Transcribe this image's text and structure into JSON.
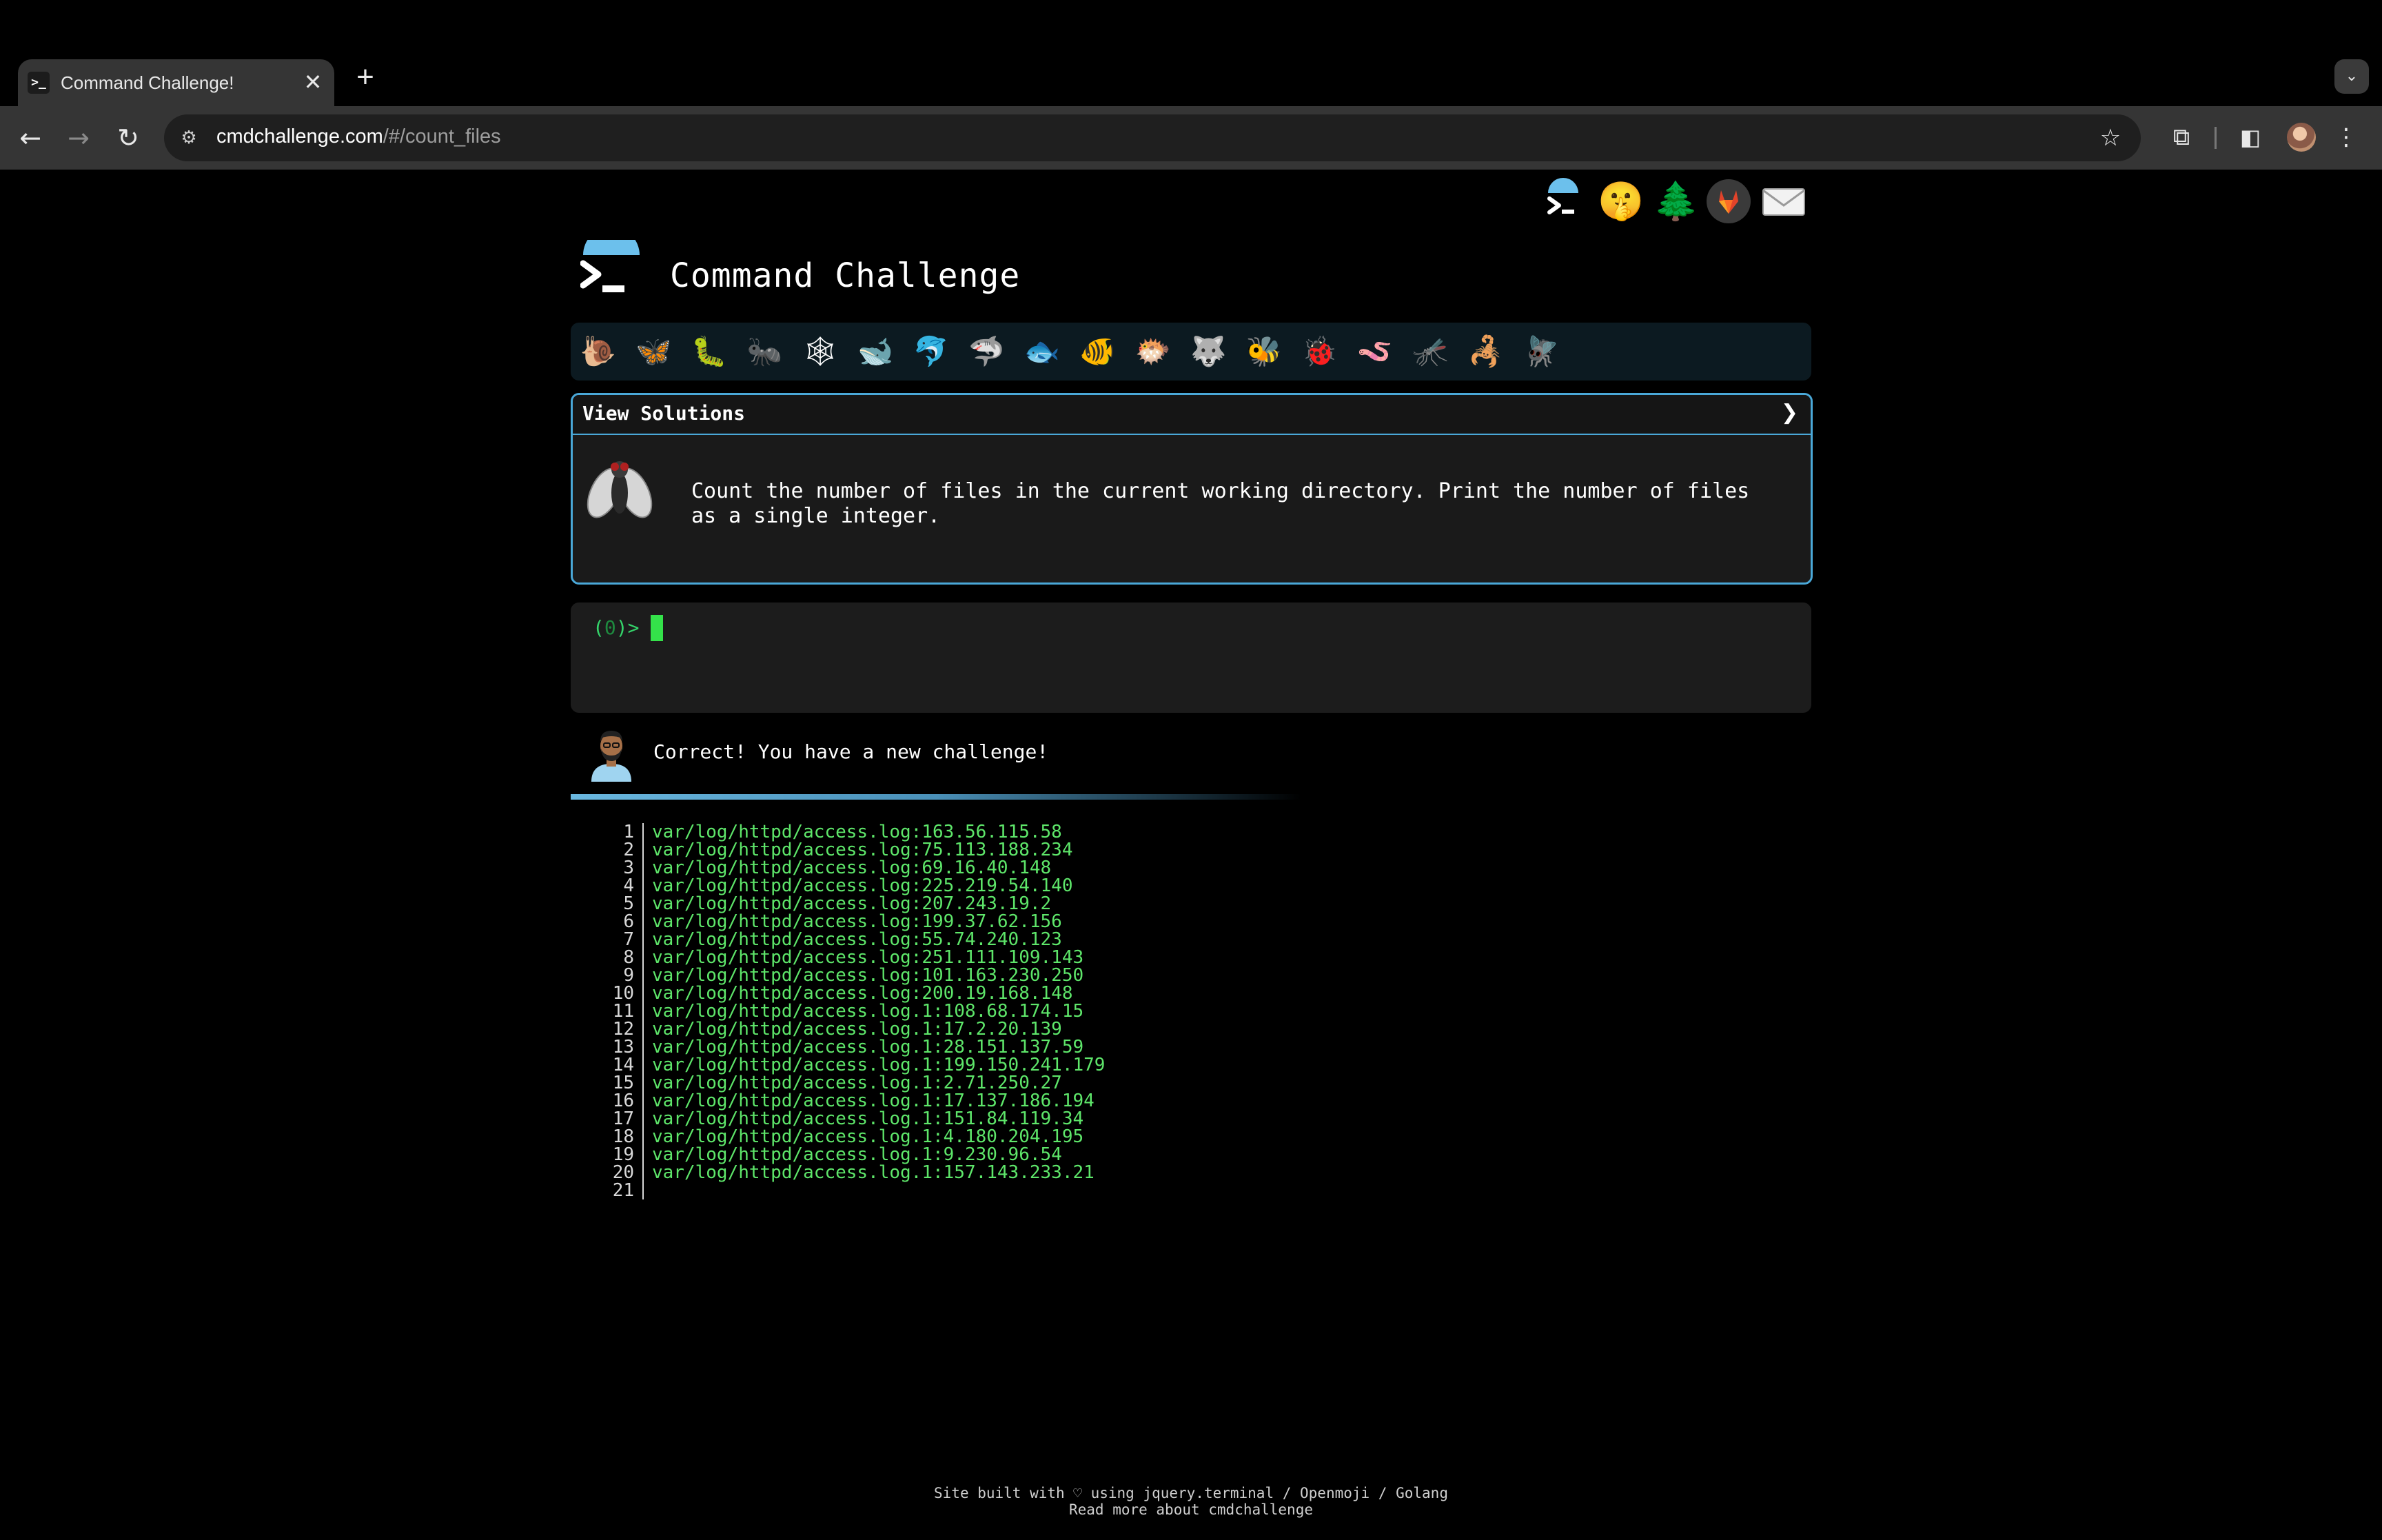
{
  "browser": {
    "tab_title": "Command Challenge!",
    "tab_favicon": ">_",
    "tab_close": "✕",
    "new_tab": "+",
    "tab_list": "⌄",
    "url_host": "cmdchallenge.com",
    "url_path": "/#/count_files",
    "back": "←",
    "forward": "→",
    "reload": "↻",
    "site_info": "⚙",
    "bookmark": "☆",
    "extensions": "⧉",
    "side_panel": "◧",
    "menu": "⋮"
  },
  "header": {
    "title": "Command Challenge",
    "top_icons": [
      "terminal-icon",
      "shushing-face-icon",
      "tree-icon",
      "gitlab-icon",
      "mail-icon"
    ]
  },
  "emoji_bar": {
    "items": [
      {
        "name": "snail-icon",
        "glyph": "🐌"
      },
      {
        "name": "butterfly-icon",
        "glyph": "🦋"
      },
      {
        "name": "caterpillar-icon",
        "glyph": "🐛"
      },
      {
        "name": "ant-icon",
        "glyph": "🐜"
      },
      {
        "name": "spider-web-icon",
        "glyph": "🕸"
      },
      {
        "name": "whale-icon",
        "glyph": "🐋"
      },
      {
        "name": "dolphin-icon",
        "glyph": "🐬"
      },
      {
        "name": "shark-icon",
        "glyph": "🦈"
      },
      {
        "name": "fish-icon",
        "glyph": "🐟"
      },
      {
        "name": "tropical-fish-icon",
        "glyph": "🐠"
      },
      {
        "name": "blowfish-icon",
        "glyph": "🐡"
      },
      {
        "name": "wolf-icon",
        "glyph": "🐺"
      },
      {
        "name": "bee-icon",
        "glyph": "🐝"
      },
      {
        "name": "ladybug-icon",
        "glyph": "🐞"
      },
      {
        "name": "worm-icon",
        "glyph": "🪱"
      },
      {
        "name": "mosquito-icon",
        "glyph": "🦟"
      },
      {
        "name": "scorpion-icon",
        "glyph": "🦂"
      },
      {
        "name": "fly-icon",
        "glyph": "🪰"
      }
    ]
  },
  "solutions": {
    "label": "View Solutions",
    "chevron": "❯",
    "challenge_text": "Count the number of files in the current working directory. Print the number of files as a single integer."
  },
  "terminal": {
    "prompt_open": "(",
    "prompt_count": "0",
    "prompt_close": ")>"
  },
  "message": {
    "text": "Correct! You have a new challenge!"
  },
  "output": [
    {
      "n": "1",
      "text": "var/log/httpd/access.log:163.56.115.58"
    },
    {
      "n": "2",
      "text": "var/log/httpd/access.log:75.113.188.234"
    },
    {
      "n": "3",
      "text": "var/log/httpd/access.log:69.16.40.148"
    },
    {
      "n": "4",
      "text": "var/log/httpd/access.log:225.219.54.140"
    },
    {
      "n": "5",
      "text": "var/log/httpd/access.log:207.243.19.2"
    },
    {
      "n": "6",
      "text": "var/log/httpd/access.log:199.37.62.156"
    },
    {
      "n": "7",
      "text": "var/log/httpd/access.log:55.74.240.123"
    },
    {
      "n": "8",
      "text": "var/log/httpd/access.log:251.111.109.143"
    },
    {
      "n": "9",
      "text": "var/log/httpd/access.log:101.163.230.250"
    },
    {
      "n": "10",
      "text": "var/log/httpd/access.log:200.19.168.148"
    },
    {
      "n": "11",
      "text": "var/log/httpd/access.log.1:108.68.174.15"
    },
    {
      "n": "12",
      "text": "var/log/httpd/access.log.1:17.2.20.139"
    },
    {
      "n": "13",
      "text": "var/log/httpd/access.log.1:28.151.137.59"
    },
    {
      "n": "14",
      "text": "var/log/httpd/access.log.1:199.150.241.179"
    },
    {
      "n": "15",
      "text": "var/log/httpd/access.log.1:2.71.250.27"
    },
    {
      "n": "16",
      "text": "var/log/httpd/access.log.1:17.137.186.194"
    },
    {
      "n": "17",
      "text": "var/log/httpd/access.log.1:151.84.119.34"
    },
    {
      "n": "18",
      "text": "var/log/httpd/access.log.1:4.180.204.195"
    },
    {
      "n": "19",
      "text": "var/log/httpd/access.log.1:9.230.96.54"
    },
    {
      "n": "20",
      "text": "var/log/httpd/access.log.1:157.143.233.21"
    },
    {
      "n": "21",
      "text": ""
    }
  ],
  "footer": {
    "line1": "Site built with ♡ using jquery.terminal / Openmoji / Golang",
    "line2": "Read more about cmdchallenge"
  },
  "colors": {
    "accent_blue": "#4aa8d8",
    "terminal_green": "#5ee66a",
    "cursor_green": "#34e24a"
  }
}
